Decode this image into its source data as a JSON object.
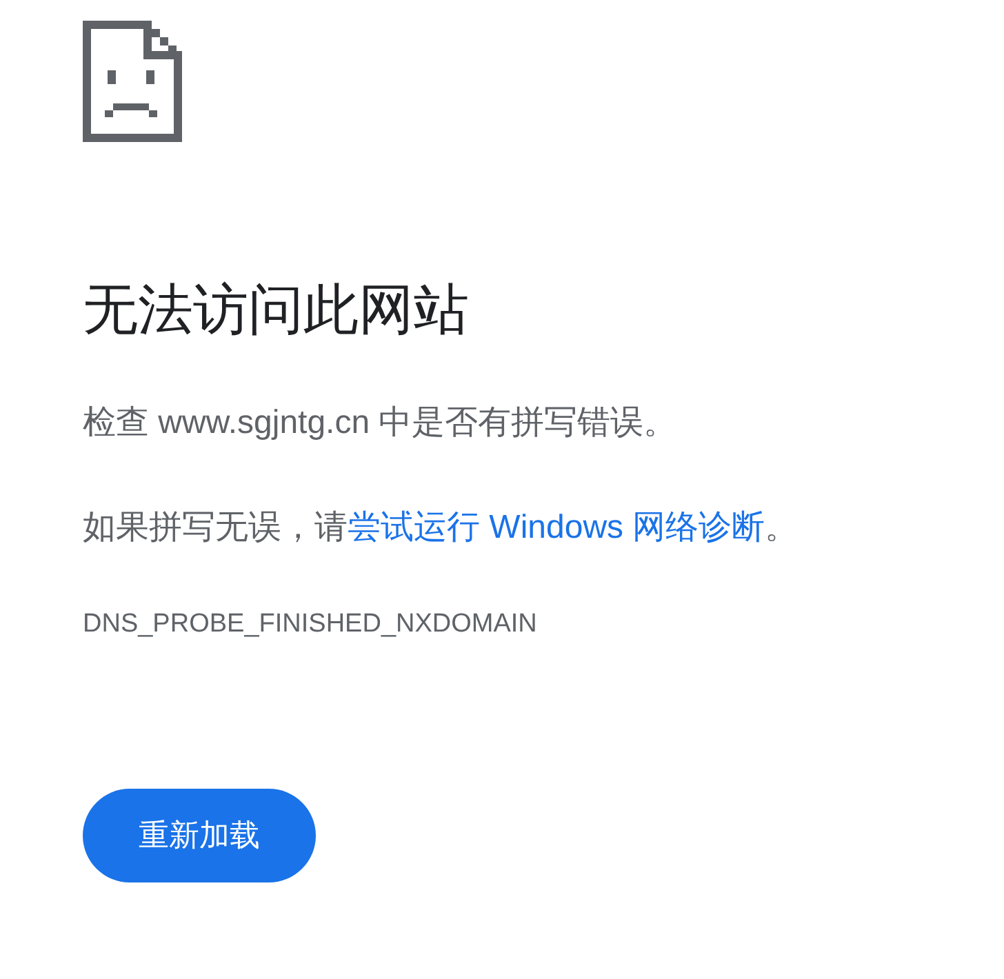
{
  "title": "无法访问此网站",
  "check_message": "检查 www.sgjntg.cn 中是否有拼写错误。",
  "hint_message": {
    "before": "如果拼写无误，请",
    "link": "尝试运行 Windows 网络诊断",
    "after": "。"
  },
  "error_code": "DNS_PROBE_FINISHED_NXDOMAIN",
  "button": "重新加载"
}
